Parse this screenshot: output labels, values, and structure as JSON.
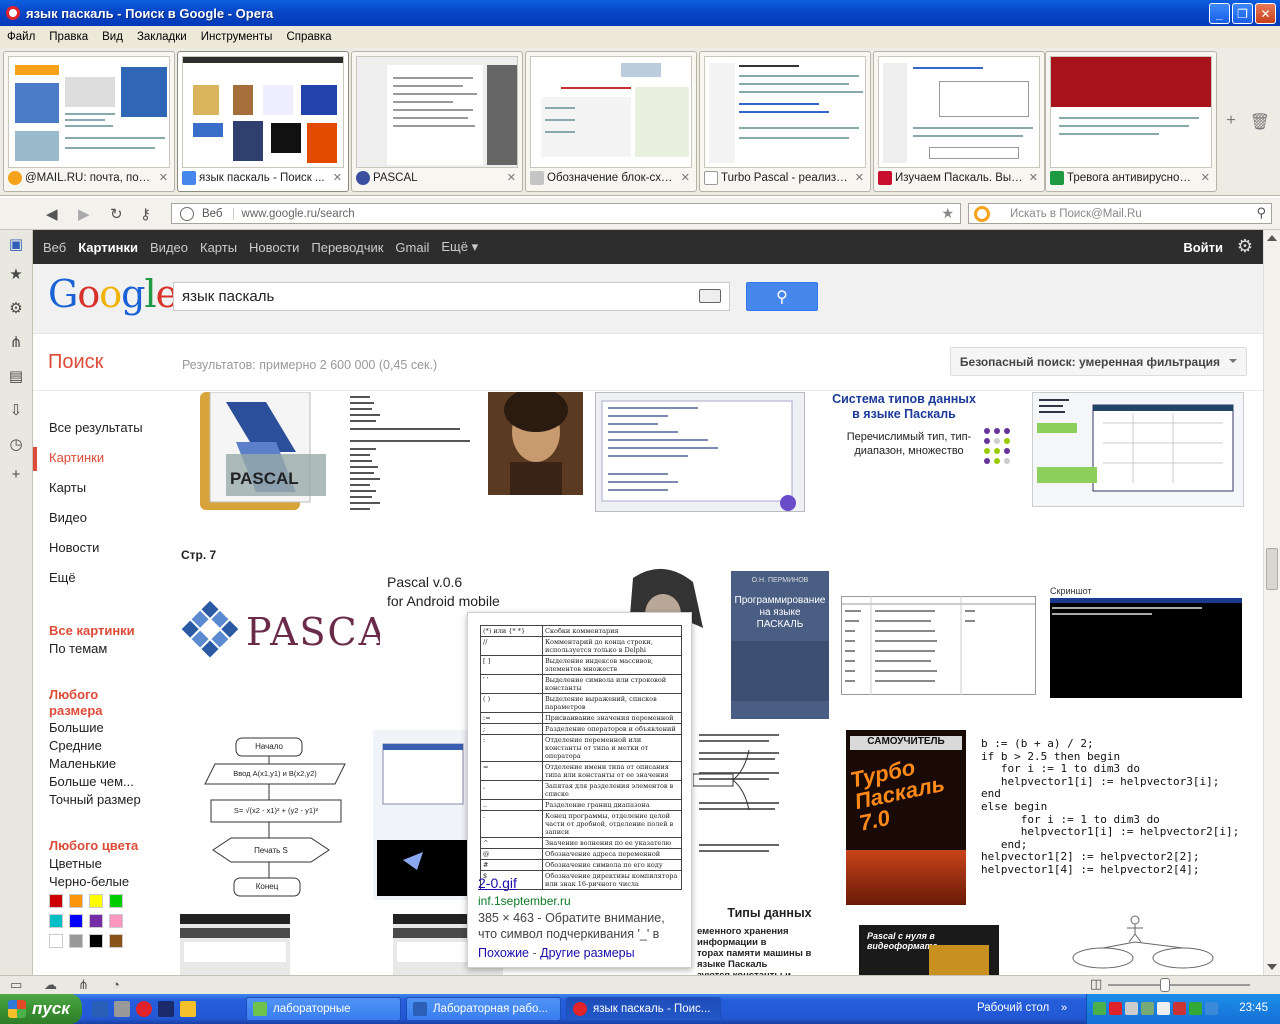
{
  "window": {
    "title": "язык паскаль - Поиск в Google - Opera",
    "controls": [
      "minimize",
      "maximize",
      "close"
    ]
  },
  "menu": [
    "Файл",
    "Правка",
    "Вид",
    "Закладки",
    "Инструменты",
    "Справка"
  ],
  "tabs": [
    {
      "label": "@MAIL.RU: почта, пои...",
      "favicon_color": "#f6a21a"
    },
    {
      "label": "язык паскаль - Поиск ...",
      "favicon_color": "#4787ed",
      "active": true
    },
    {
      "label": "PASCAL",
      "favicon_color": "#3a4fa0"
    },
    {
      "label": "Обозначение блок-схе...",
      "favicon_color": "#c5c5c5"
    },
    {
      "label": "Turbo Pascal - реализа...",
      "favicon_color": "#ffffff"
    },
    {
      "label": "Изучаем Паскаль. Выр...",
      "favicon_color": "#c8102e"
    },
    {
      "label": "Тревога антивирусной...",
      "favicon_color": "#1e9a42"
    }
  ],
  "address_bar": {
    "mode": "Веб",
    "url": "www.google.ru/search",
    "search_placeholder": "Искать в Поиск@Mail.Ru"
  },
  "google_bar": {
    "links": [
      "Веб",
      "Картинки",
      "Видео",
      "Карты",
      "Новости",
      "Переводчик",
      "Gmail",
      "Ещё ▾"
    ],
    "active": "Картинки",
    "login": "Войти"
  },
  "search": {
    "query": "язык паскаль",
    "section_title": "Поиск",
    "results_count": "Результатов: примерно 2 600 000 (0,45 сек.)",
    "safe_search": "Безопасный поиск: умеренная фильтрация"
  },
  "left_nav": {
    "items": [
      "Все результаты",
      "Картинки",
      "Карты",
      "Видео",
      "Новости",
      "Ещё"
    ],
    "selected": "Картинки",
    "all_images": "Все картинки",
    "by_topic": "По темам",
    "size_header": "Любого размера",
    "sizes": [
      "Большие",
      "Средние",
      "Маленькие",
      "Больше чем...",
      "Точный размер"
    ],
    "color_header": "Любого цвета",
    "color_types": [
      "Цветные",
      "Черно-белые"
    ],
    "swatches": [
      "#cc0000",
      "#fb940b",
      "#ffff00",
      "#00cc00",
      "#03c0c6",
      "#0000ff",
      "#762ca7",
      "#ff98bf",
      "#ffffff",
      "#999999",
      "#000000",
      "#885418"
    ]
  },
  "page_label": "Стр. 7",
  "images": {
    "pascal_logo_text": "PASCAL",
    "android_line1": "Pascal v.0.6",
    "android_line2": "for Android mobile",
    "types_title": "Система типов данных\nв языке Паскаль",
    "types_sub": "Перечислимый тип, тип-\nдиапазон, множество",
    "book_author": "О.Н. ПЕРМИНОВ",
    "book_title": "Программирование\nна языке\nПАСКАЛЬ",
    "screenshot_label": "Скриншот",
    "turbo_top": "САМОУЧИТЕЛЬ",
    "turbo_title": "Турбо\nПаскаль\n7.0",
    "code": "b := (b + a) / 2;\nif b > 2.5 then begin\n   for i := 1 to dim3 do\n   helpvector1[i] := helpvector3[i];\nend\nelse begin\n      for i := 1 to dim3 do\n      helpvector1[i] := helpvector2[i];\n   end;\nhelpvector1[2] := helpvector2[2];\nhelpvector1[4] := helpvector2[4];",
    "flow_start": "Начало",
    "flow_input": "Ввод A(x1,y1) и B(x2,y2)",
    "flow_calc": "S= √(x2 - x1)² + (y2 - y1)²",
    "flow_print": "Печать S",
    "flow_end": "Конец",
    "data_types_title": "Типы данных",
    "data_types_text": "еменного хранения информации в\nторах памяти машины в языке Паскаль\nзуются константы и переменные. Они\nмогут быть различных типов:",
    "video_text": "Pascal с нуля в видеоформате"
  },
  "hover_card": {
    "table": [
      [
        "(*) или {* *}",
        "Скобки комментария"
      ],
      [
        "//",
        "Комментарий до конца строки, используется только в Delphi"
      ],
      [
        "[ ]",
        "Выделение индексов массивов, элементов множеств"
      ],
      [
        "' '",
        "Выделение символа или строковой константы"
      ],
      [
        "( )",
        "Выделение выражений, списков параметров"
      ],
      [
        ":=",
        "Присваивание значения переменной"
      ],
      [
        ";",
        "Разделение операторов и объявлений"
      ],
      [
        ":",
        "Отделение переменной или константы от типа и метки от оператора"
      ],
      [
        "=",
        "Отделение имени типа от описания типа или константы от ее значения"
      ],
      [
        ",",
        "Запятая для разделения элементов в списке"
      ],
      [
        "..",
        "Разделение границ диапазона"
      ],
      [
        ".",
        "Конец программы, отделение целой части от дробной, отделение полей в записи"
      ],
      [
        "^",
        "Значение волнения по ее указателю"
      ],
      [
        "@",
        "Обозначение адреса переменной"
      ],
      [
        "#",
        "Обозначение символа по его коду"
      ],
      [
        "$",
        "Обозначение директивы компилятора или знак 16-ричного числа"
      ]
    ],
    "filename": "2-0.gif",
    "site": "inf.1september.ru",
    "desc": "385 × 463 - Обратите внимание, что символ подчеркивания '_' в",
    "similar": "Похожие",
    "sep": " - ",
    "other_sizes": "Другие размеры"
  },
  "taskbar": {
    "start": "пуск",
    "buttons": [
      {
        "label": "лабораторные",
        "icon_color": "#6cc24a"
      },
      {
        "label": "Лабораторная рабо...",
        "icon_color": "#2b5fb8"
      },
      {
        "label": "язык паскаль - Поис...",
        "icon_color": "#e0232b",
        "active": true
      }
    ],
    "desktop": "Рабочий стол",
    "clock": "23:45"
  }
}
